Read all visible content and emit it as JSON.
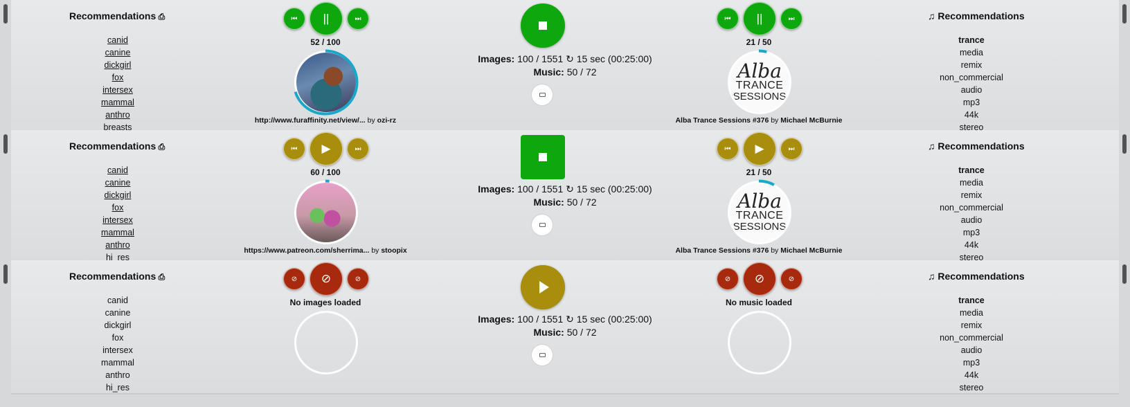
{
  "left_heading": "Recommendations",
  "right_heading": "Recommendations",
  "export_icon": "export-icon",
  "music_note": "♫",
  "music_tags": [
    "trance",
    "media",
    "remix",
    "non_commercial",
    "audio",
    "mp3",
    "44k",
    "stereo"
  ],
  "colors": {
    "green": "#0ea80e",
    "gold": "#a98d0c",
    "red": "#a82a0e",
    "progress": "#1ba7c8"
  },
  "rows": [
    {
      "state": "playing",
      "image_tags": [
        "canid",
        "canine",
        "dickgirl",
        "fox",
        "intersex",
        "mammal",
        "anthro",
        "breasts"
      ],
      "image_counter": "52 / 100",
      "image_progress": 0.7,
      "image_source": "http://www.furaffinity.net/view/...",
      "image_by": "by",
      "image_artist": "ozi-rz",
      "center_button": "stop",
      "status_images_label": "Images:",
      "status_images_value": "100 / 1551 ↻ 15 sec (00:25:00)",
      "status_music_label": "Music:",
      "status_music_value": "50 / 72",
      "music_counter": "21 / 50",
      "music_progress": 0.04,
      "music_title": "Alba Trance Sessions #376",
      "music_by": "by",
      "music_artist": "Michael McBurnie",
      "cover_text": [
        "Alba",
        "TRANCE",
        "SESSIONS"
      ]
    },
    {
      "state": "paused",
      "image_tags": [
        "canid",
        "canine",
        "dickgirl",
        "fox",
        "intersex",
        "mammal",
        "anthro",
        "hi_res"
      ],
      "image_counter": "60 / 100",
      "image_progress": 0.02,
      "image_source": "https://www.patreon.com/sherrima...",
      "image_by": "by",
      "image_artist": "stoopix",
      "center_button": "stop",
      "status_images_label": "Images:",
      "status_images_value": "100 / 1551 ↻ 15 sec (00:25:00)",
      "status_music_label": "Music:",
      "status_music_value": "50 / 72",
      "music_counter": "21 / 50",
      "music_progress": 0.08,
      "music_title": "Alba Trance Sessions #376",
      "music_by": "by",
      "music_artist": "Michael McBurnie",
      "cover_text": [
        "Alba",
        "TRANCE",
        "SESSIONS"
      ]
    },
    {
      "state": "disabled",
      "image_tags": [
        "canid",
        "canine",
        "dickgirl",
        "fox",
        "intersex",
        "mammal",
        "anthro",
        "hi_res"
      ],
      "image_counter": "No images loaded",
      "image_progress": 0,
      "center_button": "play",
      "status_images_label": "Images:",
      "status_images_value": "100 / 1551 ↻ 15 sec (00:25:00)",
      "status_music_label": "Music:",
      "status_music_value": "50 / 72",
      "music_counter": "No music loaded",
      "music_progress": 0
    }
  ]
}
